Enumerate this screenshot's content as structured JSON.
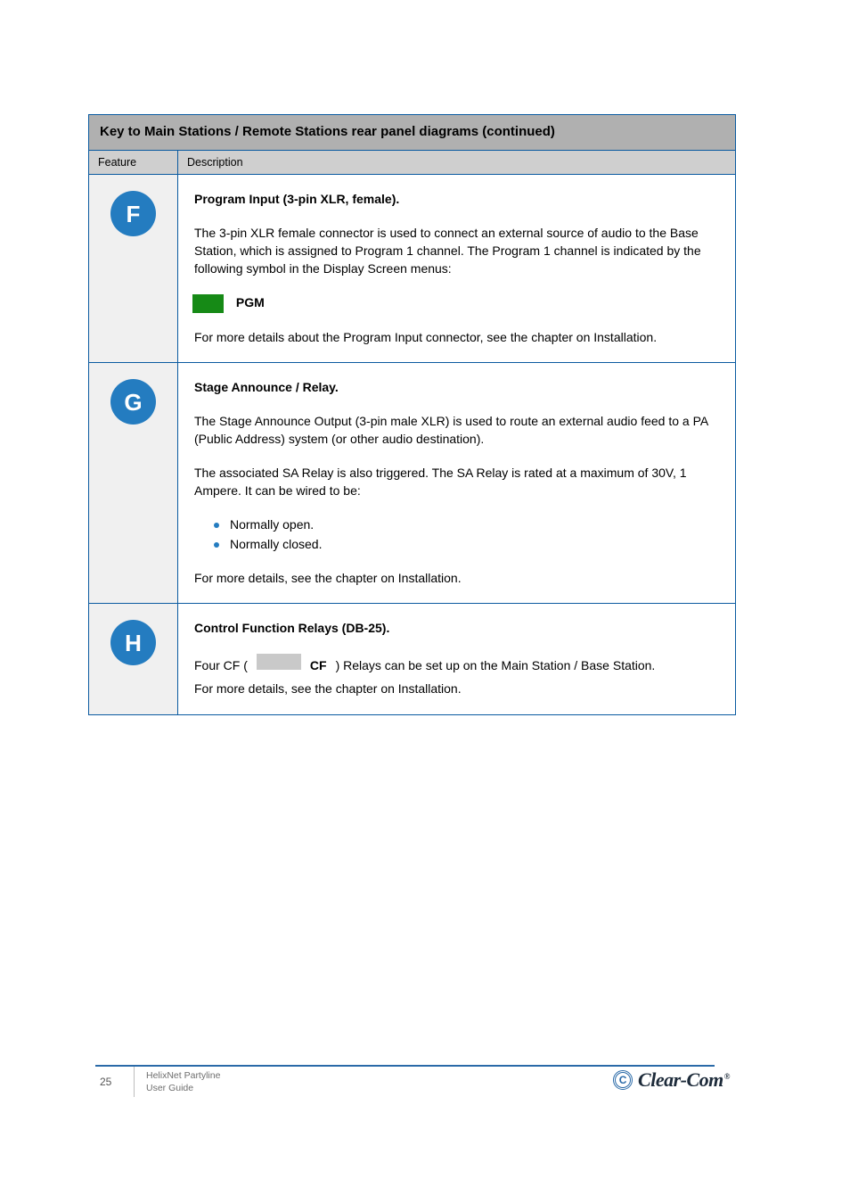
{
  "table": {
    "banner": "Key to Main Stations / Remote Stations rear panel diagrams (continued)",
    "header_feature": "Feature",
    "header_desc": "Description",
    "rows": [
      {
        "num": "F",
        "title": "Program Input (3-pin XLR, female).",
        "para1": "The 3-pin XLR female connector is used to connect an external source of audio to the Base Station, which is assigned to Program 1 channel. The Program 1 channel is indicated by the following symbol in the Display Screen menus:",
        "para2_after": "PGM",
        "para3": "For more details about the Program Input connector, see the chapter on Installation."
      },
      {
        "num": "G",
        "title": "Stage Announce / Relay.",
        "para1": "The Stage Announce Output (3-pin male XLR) is used to route an external audio feed to a PA (Public Address) system (or other audio destination).",
        "para2": "The associated SA Relay is also triggered. The SA Relay is rated at a maximum of 30V, 1 Ampere. It can be wired to be:",
        "bullet1": "Normally open.",
        "bullet2": "Normally closed.",
        "para3": "For more details, see the chapter on Installation."
      },
      {
        "num": "H",
        "title": "Control Function Relays (DB-25).",
        "cf_prefix": "Four CF (",
        "cf_swatch_label": "CF",
        "cf_suffix": ") Relays can be set up on the Main Station / Base Station.",
        "para2": "For more details, see the chapter on Installation."
      }
    ]
  },
  "footer": {
    "page_number": "25",
    "doc_line1": "HelixNet Partyline",
    "doc_line2": "User Guide",
    "logo_text": "Clear-Com"
  }
}
